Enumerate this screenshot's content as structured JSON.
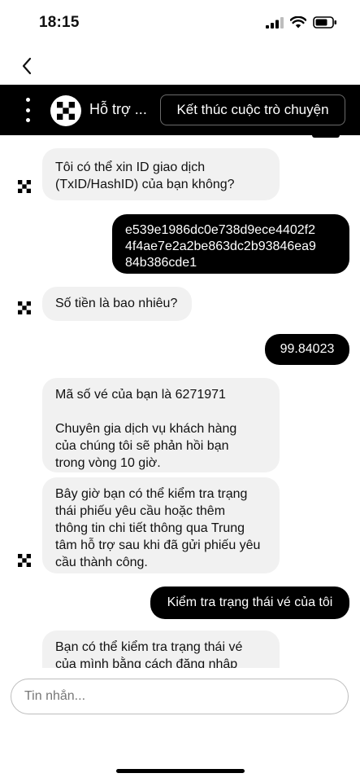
{
  "status_bar": {
    "time": "18:15",
    "icons": [
      "signal-icon",
      "wifi-icon",
      "battery-icon"
    ]
  },
  "nav": {
    "back_icon": "chevron-left-icon"
  },
  "header": {
    "agent_name": "Hỗ trợ ...",
    "end_chat_label": "Kết thúc cuộc trò chuyện",
    "menu_icon": "vertical-dots-icon",
    "avatar_icon": "okx-logo-icon"
  },
  "messages": [
    {
      "sender": "agent",
      "text": "Tôi có thể xin ID giao dịch\n(TxID/HashID) của bạn không?"
    },
    {
      "sender": "user",
      "text": "e539e1986dc0e738d9ece4402f2\n4f4ae7e2a2be863dc2b93846ea9\n84b386cde1"
    },
    {
      "sender": "agent",
      "text": "Số tiền là bao nhiêu?"
    },
    {
      "sender": "user",
      "text": "99.84023"
    },
    {
      "sender": "agent",
      "text": "Mã số vé của bạn là 6271971\n\nChuyên gia dịch vụ khách hàng\ncủa chúng tôi sẽ phản hồi bạn\ntrong vòng 10 giờ."
    },
    {
      "sender": "agent",
      "text": "Bây giờ bạn có thể kiểm tra trạng\nthái phiếu yêu cầu hoặc thêm\nthông tin chi tiết thông qua Trung\ntâm hỗ trợ sau khi đã gửi phiếu yêu\ncầu thành công."
    },
    {
      "sender": "user",
      "text": "Kiểm tra trạng thái vé của tôi"
    },
    {
      "sender": "agent",
      "text": "Bạn có thể kiểm tra trạng thái vé\ncủa mình bằng cách đăng nhập"
    }
  ],
  "input": {
    "placeholder": "Tin nhắn..."
  },
  "colors": {
    "header_bg": "#000000",
    "agent_bubble": "#f1f1f1",
    "user_bubble": "#000000"
  }
}
